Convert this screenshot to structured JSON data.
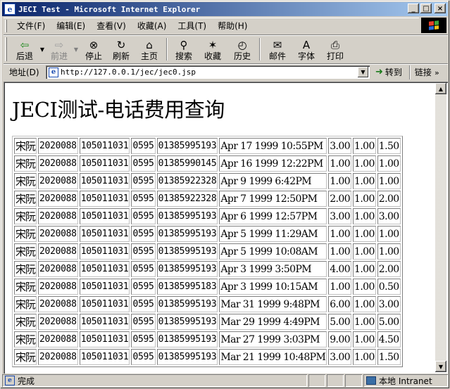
{
  "window": {
    "title": "JECI Test - Microsoft Internet Explorer",
    "buttons": {
      "minimize": "_",
      "maximize": "□",
      "close": "×"
    }
  },
  "menu": [
    "文件(F)",
    "编辑(E)",
    "查看(V)",
    "收藏(A)",
    "工具(T)",
    "帮助(H)"
  ],
  "toolbar": {
    "back": "后退",
    "forward": "前进",
    "stop": "停止",
    "refresh": "刷新",
    "home": "主页",
    "search": "搜索",
    "favorites": "收藏",
    "history": "历史",
    "mail": "邮件",
    "font": "字体",
    "print": "打印"
  },
  "address": {
    "label": "地址(D)",
    "url": "http://127.0.0.1/jec/jec0.jsp",
    "go": "转到",
    "links": "链接"
  },
  "page": {
    "heading": "JECI测试-电话费用查询",
    "rows": [
      [
        "宋阮",
        "2020088",
        "105011031",
        "0595",
        "01385995193",
        "Apr 17 1999 10:55PM",
        "3.00",
        "1.00",
        "1.50"
      ],
      [
        "宋阮",
        "2020088",
        "105011031",
        "0595",
        "01385990145",
        "Apr 16 1999 12:22PM",
        "1.00",
        "1.00",
        "1.00"
      ],
      [
        "宋阮",
        "2020088",
        "105011031",
        "0595",
        "01385922328",
        "Apr 9 1999 6:42PM",
        "1.00",
        "1.00",
        "1.00"
      ],
      [
        "宋阮",
        "2020088",
        "105011031",
        "0595",
        "01385922328",
        "Apr 7 1999 12:50PM",
        "2.00",
        "1.00",
        "2.00"
      ],
      [
        "宋阮",
        "2020088",
        "105011031",
        "0595",
        "01385995193",
        "Apr 6 1999 12:57PM",
        "3.00",
        "1.00",
        "3.00"
      ],
      [
        "宋阮",
        "2020088",
        "105011031",
        "0595",
        "01385995193",
        "Apr 5 1999 11:29AM",
        "1.00",
        "1.00",
        "1.00"
      ],
      [
        "宋阮",
        "2020088",
        "105011031",
        "0595",
        "01385995193",
        "Apr 5 1999 10:08AM",
        "1.00",
        "1.00",
        "1.00"
      ],
      [
        "宋阮",
        "2020088",
        "105011031",
        "0595",
        "01385995193",
        "Apr 3 1999 3:50PM",
        "4.00",
        "1.00",
        "2.00"
      ],
      [
        "宋阮",
        "2020088",
        "105011031",
        "0595",
        "01385995183",
        "Apr 3 1999 10:15AM",
        "1.00",
        "1.00",
        "0.50"
      ],
      [
        "宋阮",
        "2020088",
        "105011031",
        "0595",
        "01385995193",
        "Mar 31 1999 9:48PM",
        "6.00",
        "1.00",
        "3.00"
      ],
      [
        "宋阮",
        "2020088",
        "105011031",
        "0595",
        "01385995193",
        "Mar 29 1999 4:49PM",
        "5.00",
        "1.00",
        "5.00"
      ],
      [
        "宋阮",
        "2020088",
        "105011031",
        "0595",
        "01385995193",
        "Mar 27 1999 3:03PM",
        "9.00",
        "1.00",
        "4.50"
      ],
      [
        "宋阮",
        "2020088",
        "105011031",
        "0595",
        "01385995193",
        "Mar 21 1999 10:48PM",
        "3.00",
        "1.00",
        "1.50"
      ]
    ]
  },
  "status": {
    "text": "完成",
    "zone": "本地 Intranet"
  },
  "icons": {
    "back": "back-arrow-icon",
    "forward": "forward-arrow-icon",
    "stop": "stop-icon",
    "refresh": "refresh-icon",
    "home": "home-icon",
    "search": "search-icon",
    "favorites": "favorites-icon",
    "history": "history-icon",
    "mail": "mail-icon",
    "font": "font-icon",
    "print": "printer-icon"
  },
  "colors": {
    "titlebar_start": "#0a246a",
    "titlebar_end": "#a6caf0",
    "chrome": "#d4d0c8"
  }
}
